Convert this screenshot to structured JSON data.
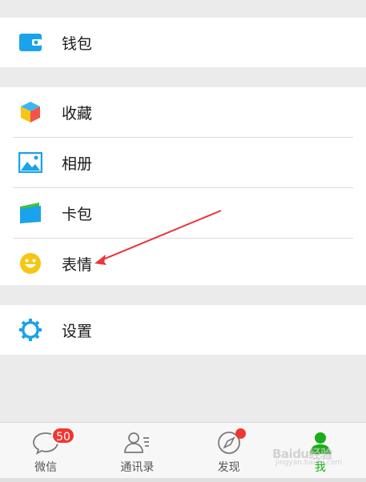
{
  "menu": {
    "wallet": {
      "label": "钱包",
      "icon": "wallet-icon",
      "color": "#1aa3ea"
    },
    "favorites": {
      "label": "收藏",
      "icon": "favorites-cube-icon"
    },
    "album": {
      "label": "相册",
      "icon": "album-icon",
      "color": "#1aa3ea"
    },
    "cards": {
      "label": "卡包",
      "icon": "card-wallet-icon"
    },
    "stickers": {
      "label": "表情",
      "icon": "smiley-icon",
      "color": "#f7c613"
    },
    "settings": {
      "label": "设置",
      "icon": "gear-icon",
      "color": "#1aa3ea"
    }
  },
  "tabbar": {
    "tabs": [
      {
        "label": "微信",
        "icon": "chat-bubble-icon",
        "badge": "50"
      },
      {
        "label": "通讯录",
        "icon": "contacts-icon"
      },
      {
        "label": "发现",
        "icon": "compass-icon",
        "dot": true
      },
      {
        "label": "我",
        "icon": "me-icon",
        "active": true
      }
    ],
    "active_color": "#1aad19"
  },
  "watermark": {
    "text": "Baidu经验",
    "sub": "jingyan.baidu.com"
  },
  "annotation": {
    "type": "arrow",
    "color": "#e8363a",
    "points_to": "表情"
  }
}
